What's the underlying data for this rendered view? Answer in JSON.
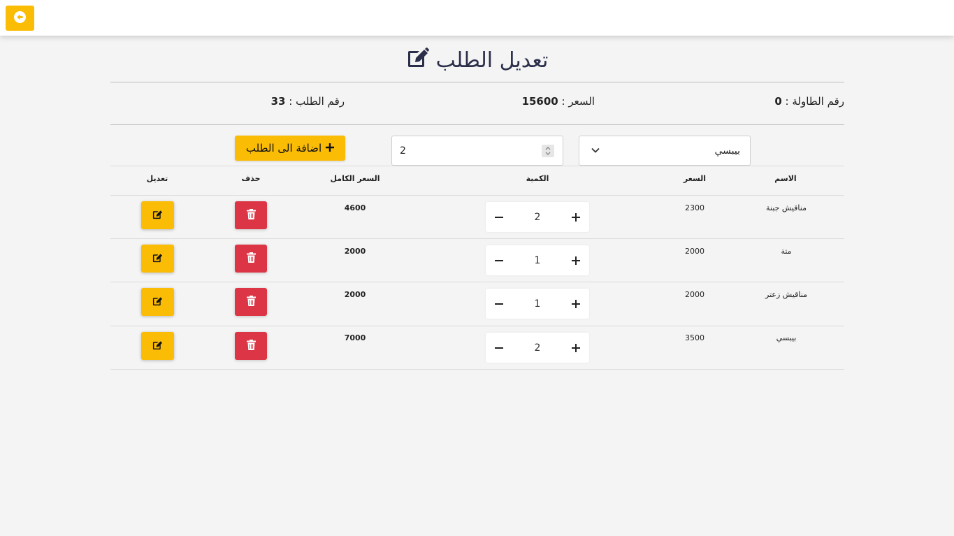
{
  "page": {
    "title": "تعديل الطلب"
  },
  "order_info": {
    "table_label": "رقم الطاولة :",
    "table_value": "0",
    "price_label": "السعر :",
    "price_value": "15600",
    "order_label": "رقم الطلب :",
    "order_value": "33"
  },
  "form": {
    "selected_item": "بيبسي",
    "quantity": "2",
    "add_label": "اضافة الى الطلب"
  },
  "table": {
    "headers": {
      "name": "الاسم",
      "price": "السعر",
      "quantity": "الكمية",
      "total": "السعر الكامل",
      "delete": "حذف",
      "edit": "تعديل"
    },
    "rows": [
      {
        "name": "مناقيش جبنة",
        "price": "2300",
        "quantity": "2",
        "total": "4600"
      },
      {
        "name": "متة",
        "price": "2000",
        "quantity": "1",
        "total": "2000"
      },
      {
        "name": "مناقيش زعتر",
        "price": "2000",
        "quantity": "1",
        "total": "2000"
      },
      {
        "name": "بيبسي",
        "price": "3500",
        "quantity": "2",
        "total": "7000"
      }
    ]
  },
  "colors": {
    "accent": "#fbbc05",
    "danger": "#dc3545",
    "title": "#2b2f4a"
  },
  "icons": {
    "back": "arrow-circle-left-icon",
    "title": "edit-square-icon",
    "add": "plus-icon",
    "delete": "trash-icon",
    "edit": "edit-icon"
  }
}
